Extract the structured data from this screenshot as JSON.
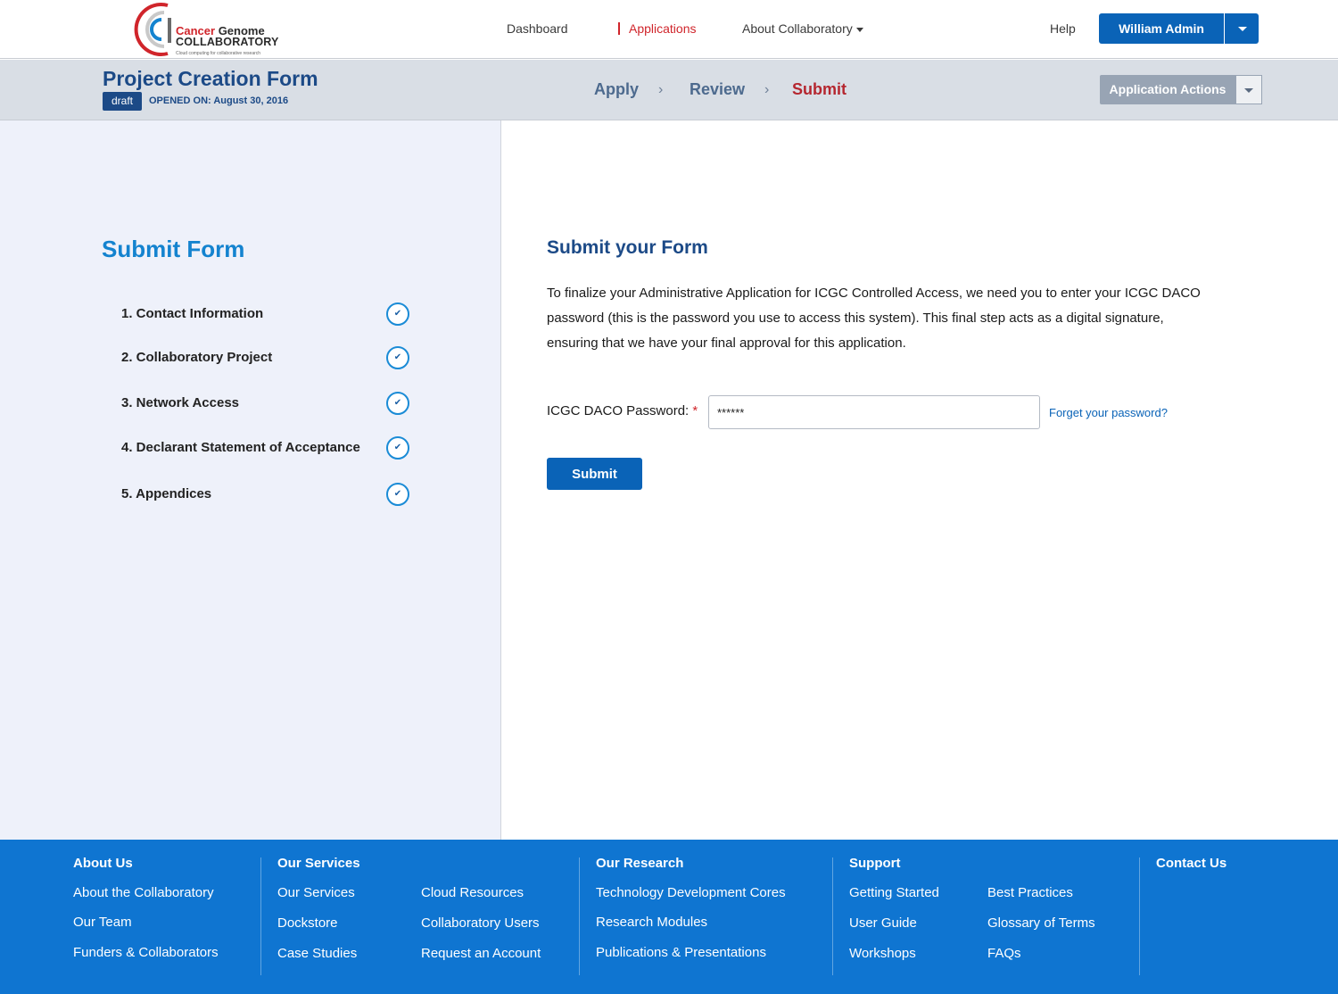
{
  "brand": {
    "line1_red": "Cancer",
    "line1_rest": " Genome",
    "line2": "COLLABORATORY",
    "tagline": "Cloud computing for collaborative research"
  },
  "nav": {
    "dashboard": "Dashboard",
    "applications": "Applications",
    "about": "About Collaboratory",
    "help": "Help",
    "user": "William Admin"
  },
  "form_header": {
    "title": "Project Creation Form",
    "status_badge": "draft",
    "opened": "OPENED ON: August 30, 2016",
    "steps": [
      "Apply",
      "Review",
      "Submit"
    ],
    "current_step": "Submit",
    "actions_label": "Application Actions"
  },
  "sidebar": {
    "heading": "Submit Form",
    "items": [
      {
        "label": "1.  Contact Information",
        "complete": true
      },
      {
        "label": "2.  Collaboratory Project",
        "complete": true
      },
      {
        "label": "3.  Network Access",
        "complete": true
      },
      {
        "label": "4. Declarant Statement of Acceptance",
        "complete": true
      },
      {
        "label": "5. Appendices",
        "complete": true
      }
    ]
  },
  "main": {
    "heading": "Submit your Form",
    "paragraph": "To finalize your Administrative Application for ICGC Controlled Access, we need you to enter your ICGC DACO password (this is the password you use to access this system). This final step acts as a digital signature, ensuring that we have your final approval for this application.",
    "password_label": "ICGC DACO Password:",
    "required_mark": "*",
    "password_value": "******",
    "forgot_link": "Forget your password?",
    "submit_label": "Submit"
  },
  "footer": {
    "about": {
      "heading": "About Us",
      "links": [
        "About the Collaboratory",
        "Our Team",
        "Funders & Collaborators"
      ]
    },
    "services": {
      "heading": "Our Services",
      "col1": [
        "Our Services",
        "Dockstore",
        "Case Studies"
      ],
      "col2": [
        "Cloud Resources",
        "Collaboratory Users",
        "Request an Account"
      ]
    },
    "research": {
      "heading": "Our Research",
      "links": [
        "Technology Development Cores",
        "Research Modules",
        "Publications & Presentations"
      ]
    },
    "support": {
      "heading": "Support",
      "col1": [
        "Getting Started",
        "User Guide",
        "Workshops"
      ],
      "col2": [
        "Best Practices",
        "Glossary of Terms",
        "FAQs"
      ]
    },
    "contact": {
      "heading": "Contact Us"
    }
  },
  "colors": {
    "primary": "#0a63b7",
    "accent_red": "#d0252b",
    "footer_bg": "#0f75d1",
    "sidebar_bg": "#eef1fa"
  }
}
